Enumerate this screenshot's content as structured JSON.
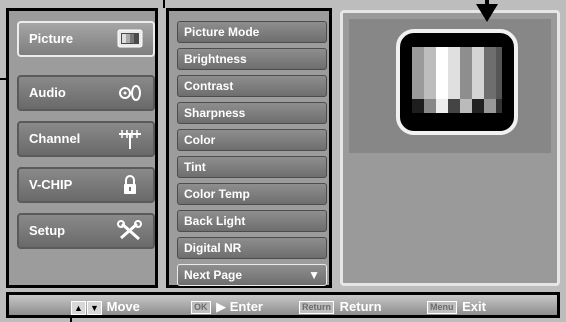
{
  "menu": {
    "categories": [
      {
        "label": "Picture",
        "icon": "tv-icon",
        "selected": true
      },
      {
        "label": "Audio",
        "icon": "speaker-icon",
        "selected": false
      },
      {
        "label": "Channel",
        "icon": "antenna-icon",
        "selected": false
      },
      {
        "label": "V-CHIP",
        "icon": "lock-icon",
        "selected": false
      },
      {
        "label": "Setup",
        "icon": "tools-icon",
        "selected": false
      }
    ],
    "items": [
      {
        "label": "Picture Mode"
      },
      {
        "label": "Brightness"
      },
      {
        "label": "Contrast"
      },
      {
        "label": "Sharpness"
      },
      {
        "label": "Color"
      },
      {
        "label": "Tint"
      },
      {
        "label": "Color Temp"
      },
      {
        "label": "Back Light"
      },
      {
        "label": "Digital NR"
      },
      {
        "label": "Next Page",
        "arrow": "▼"
      }
    ]
  },
  "help": {
    "move_label": "Move",
    "enter_key": "OK",
    "enter_label": "Enter",
    "return_key": "Return",
    "return_label": "Return",
    "exit_key": "Menu",
    "exit_label": "Exit"
  },
  "colors": {
    "frame_bg": "#bdbdbd",
    "panel_bg": "#9c9c9c",
    "text": "#ffffff"
  }
}
